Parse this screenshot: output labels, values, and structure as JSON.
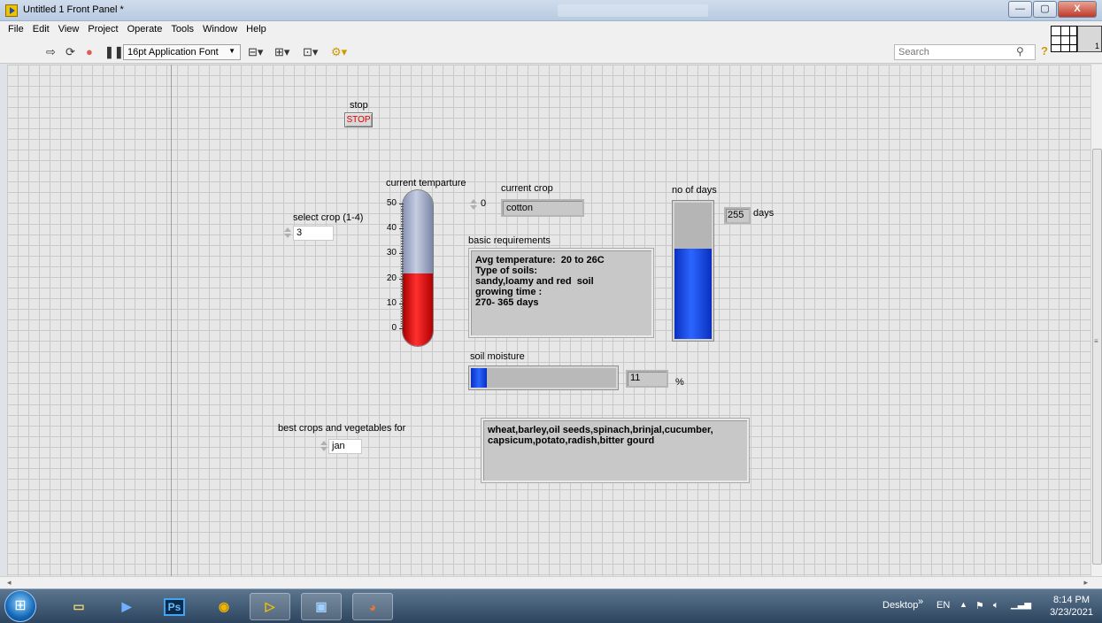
{
  "window": {
    "title": "Untitled 1 Front Panel *",
    "min_label": "—",
    "max_label": "▢",
    "close_label": "X"
  },
  "menu": [
    "File",
    "Edit",
    "View",
    "Project",
    "Operate",
    "Tools",
    "Window",
    "Help"
  ],
  "toolbar": {
    "font": "16pt Application Font",
    "search_placeholder": "Search",
    "vi_icon_label": "1",
    "icons": [
      "run-arrow-icon",
      "run-continuously-icon",
      "abort-icon",
      "pause-icon",
      "align-icon",
      "distribute-icon",
      "resize-icon",
      "reorder-icon"
    ]
  },
  "panel": {
    "stop": {
      "label": "stop",
      "button": "STOP"
    },
    "select_crop": {
      "label": "select crop (1-4)",
      "value": "3"
    },
    "thermometer": {
      "label": "current temparture",
      "ticks": [
        "50",
        "40",
        "30",
        "20",
        "10",
        "0"
      ],
      "min": 0,
      "max": 50,
      "value": 22
    },
    "current_crop": {
      "label": "current crop",
      "index": "0",
      "value": "cotton"
    },
    "basic_requirements": {
      "label": "basic requirements",
      "text": "Avg temperature:  20 to 26C\nType of soils:\nsandy,loamy and red  soil\ngrowing time :\n270- 365 days"
    },
    "no_of_days": {
      "label": "no of days",
      "value": "255",
      "unit": "days",
      "level_fraction": 0.66
    },
    "soil_moisture": {
      "label": "soil moisture",
      "value": "11",
      "unit": "%",
      "fraction": 0.11
    },
    "best_crops": {
      "label": "best crops and vegetables for",
      "month": "jan",
      "text": "wheat,barley,oil seeds,spinach,brinjal,cucumber,\ncapsicum,potato,radish,bitter gourd"
    }
  },
  "taskbar": {
    "ps_label": "Ps",
    "desktop": "Desktop",
    "chevron": "»",
    "lang": "EN",
    "time": "8:14 PM",
    "date": "3/23/2021"
  },
  "colors": {
    "thermo_fill": "#ff2f2f",
    "tank_fill": "#2b66ff",
    "stop_text": "#e00000"
  }
}
